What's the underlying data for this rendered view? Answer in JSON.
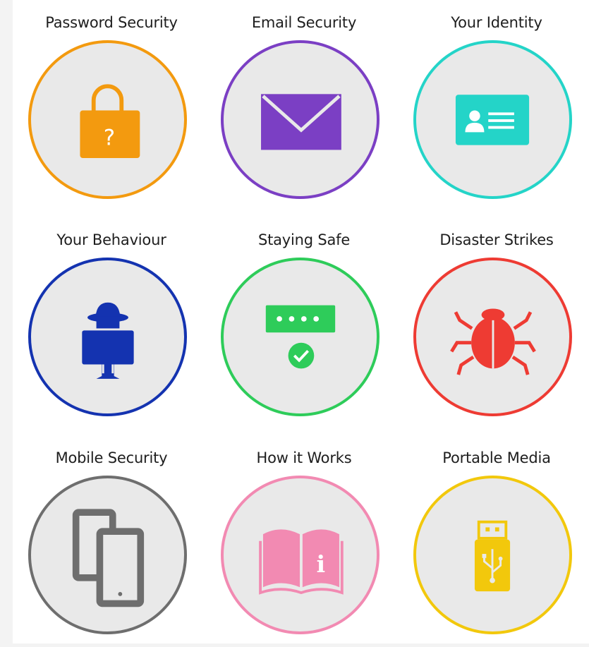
{
  "tiles": [
    {
      "label": "Password Security",
      "color": "#f39a0f",
      "icon": "padlock-question-icon"
    },
    {
      "label": "Email Security",
      "color": "#7b3fc4",
      "icon": "envelope-icon"
    },
    {
      "label": "Your Identity",
      "color": "#24d4c8",
      "icon": "id-card-icon"
    },
    {
      "label": "Your Behaviour",
      "color": "#1433b0",
      "icon": "spy-at-computer-icon"
    },
    {
      "label": "Staying Safe",
      "color": "#2ecc5a",
      "icon": "password-check-icon"
    },
    {
      "label": "Disaster Strikes",
      "color": "#ee3b33",
      "icon": "bug-icon"
    },
    {
      "label": "Mobile Security",
      "color": "#6e6e6e",
      "icon": "mobile-devices-icon"
    },
    {
      "label": "How it Works",
      "color": "#f28ab2",
      "icon": "book-info-icon"
    },
    {
      "label": "Portable Media",
      "color": "#f2c80c",
      "icon": "usb-drive-icon"
    }
  ]
}
